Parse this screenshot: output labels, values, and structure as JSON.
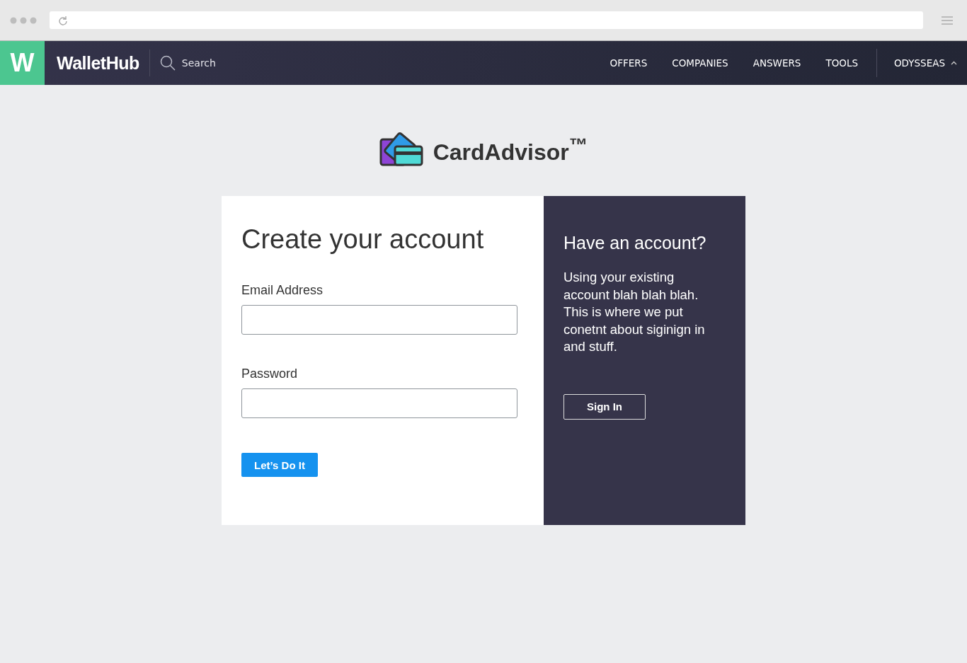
{
  "nav": {
    "logo_letter": "W",
    "brand": "WalletHub",
    "search_label": "Search",
    "links": [
      "OFFERS",
      "COMPANIES",
      "ANSWERS",
      "TOOLS"
    ],
    "user": "ODYSSEAS",
    "user_menu_expanded": true
  },
  "logo": {
    "name": "CardAdvisor$^{™}$"
  },
  "signup": {
    "title": "Create your account",
    "fields": [
      {
        "label": "Email Address"
      },
      {
        "label": "Password"
      }
    ],
    "submit": "Let’s Do It"
  },
  "signin": {
    "title": "Have an account?",
    "body": "Using your existing account blah blah blah. This is where we put conetnt about siginign in and stuff.",
    "button": "Sign In"
  }
}
